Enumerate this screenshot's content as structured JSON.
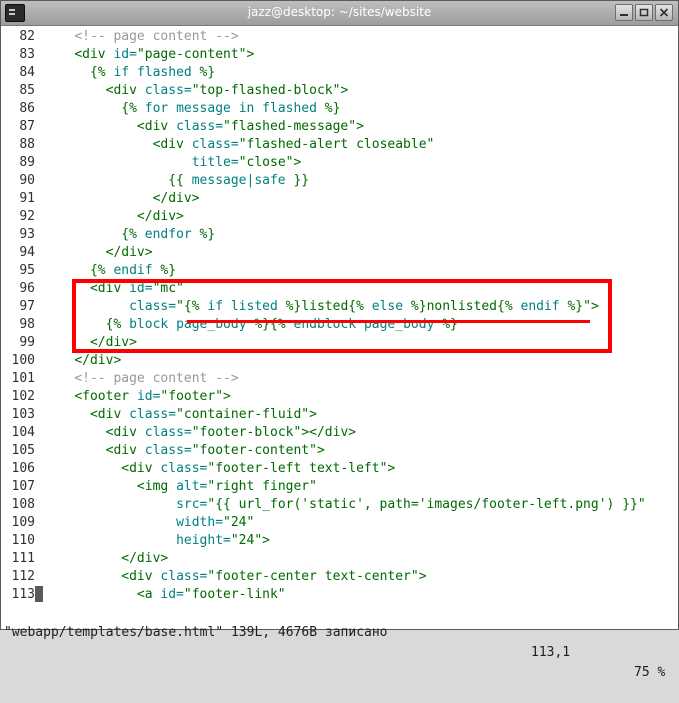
{
  "window": {
    "title": "jazz@desktop: ~/sites/website",
    "icon": "terminal-icon",
    "controls": [
      "minimize-icon",
      "maximize-icon",
      "close-icon"
    ]
  },
  "lines": [
    {
      "num": "82",
      "parts": [
        [
          "    ",
          "t"
        ],
        [
          "<!-- page content -->",
          "c"
        ]
      ]
    },
    {
      "num": "83",
      "parts": [
        [
          "    ",
          "t"
        ],
        [
          "<div ",
          "g"
        ],
        [
          "id=",
          "a"
        ],
        [
          "\"page-content\"",
          "s"
        ],
        [
          ">",
          "g"
        ]
      ]
    },
    {
      "num": "84",
      "parts": [
        [
          "      ",
          "t"
        ],
        [
          "{% ",
          "j"
        ],
        [
          "if ",
          "k"
        ],
        [
          "flashed",
          "k"
        ],
        [
          " %}",
          "j"
        ]
      ]
    },
    {
      "num": "85",
      "parts": [
        [
          "        ",
          "t"
        ],
        [
          "<div ",
          "g"
        ],
        [
          "class=",
          "a"
        ],
        [
          "\"top-flashed-block\"",
          "s"
        ],
        [
          ">",
          "g"
        ]
      ]
    },
    {
      "num": "86",
      "parts": [
        [
          "          ",
          "t"
        ],
        [
          "{% ",
          "j"
        ],
        [
          "for ",
          "k"
        ],
        [
          "message in flashed",
          "k"
        ],
        [
          " %}",
          "j"
        ]
      ]
    },
    {
      "num": "87",
      "parts": [
        [
          "            ",
          "t"
        ],
        [
          "<div ",
          "g"
        ],
        [
          "class=",
          "a"
        ],
        [
          "\"flashed-message\"",
          "s"
        ],
        [
          ">",
          "g"
        ]
      ]
    },
    {
      "num": "88",
      "parts": [
        [
          "              ",
          "t"
        ],
        [
          "<div ",
          "g"
        ],
        [
          "class=",
          "a"
        ],
        [
          "\"flashed-alert closeable\"",
          "s"
        ]
      ]
    },
    {
      "num": "89",
      "parts": [
        [
          "                   ",
          "t"
        ],
        [
          "title=",
          "a"
        ],
        [
          "\"close\"",
          "s"
        ],
        [
          ">",
          "g"
        ]
      ]
    },
    {
      "num": "90",
      "parts": [
        [
          "                ",
          "t"
        ],
        [
          "{{ ",
          "j"
        ],
        [
          "message|safe",
          "k"
        ],
        [
          " }}",
          "j"
        ]
      ]
    },
    {
      "num": "91",
      "parts": [
        [
          "              ",
          "t"
        ],
        [
          "</div>",
          "g"
        ]
      ]
    },
    {
      "num": "92",
      "parts": [
        [
          "            ",
          "t"
        ],
        [
          "</div>",
          "g"
        ]
      ]
    },
    {
      "num": "93",
      "parts": [
        [
          "          ",
          "t"
        ],
        [
          "{% ",
          "j"
        ],
        [
          "endfor",
          "k"
        ],
        [
          " %}",
          "j"
        ]
      ]
    },
    {
      "num": "94",
      "parts": [
        [
          "        ",
          "t"
        ],
        [
          "</div>",
          "g"
        ]
      ]
    },
    {
      "num": "95",
      "parts": [
        [
          "      ",
          "t"
        ],
        [
          "{% ",
          "j"
        ],
        [
          "endif",
          "k"
        ],
        [
          " %}",
          "j"
        ]
      ]
    },
    {
      "num": "96",
      "parts": [
        [
          "      ",
          "t"
        ],
        [
          "<div ",
          "g"
        ],
        [
          "id=",
          "a"
        ],
        [
          "\"mc\"",
          "s"
        ]
      ]
    },
    {
      "num": "97",
      "parts": [
        [
          "           ",
          "t"
        ],
        [
          "class=",
          "a"
        ],
        [
          "\"",
          "s"
        ],
        [
          "{% ",
          "j"
        ],
        [
          "if listed",
          "k"
        ],
        [
          " %}",
          "j"
        ],
        [
          "listed",
          "s"
        ],
        [
          "{% ",
          "j"
        ],
        [
          "else",
          "k"
        ],
        [
          " %}",
          "j"
        ],
        [
          "nonlisted",
          "s"
        ],
        [
          "{% ",
          "j"
        ],
        [
          "endif",
          "k"
        ],
        [
          " %}",
          "j"
        ],
        [
          "\"",
          "s"
        ],
        [
          ">",
          "g"
        ]
      ]
    },
    {
      "num": "98",
      "parts": [
        [
          "        ",
          "t"
        ],
        [
          "{% ",
          "j"
        ],
        [
          "block ",
          "k"
        ],
        [
          "page_body",
          "k"
        ],
        [
          " %}",
          "j"
        ],
        [
          "{% ",
          "j"
        ],
        [
          "endblock ",
          "k"
        ],
        [
          "page_body",
          "k"
        ],
        [
          " %}",
          "j"
        ]
      ]
    },
    {
      "num": "99",
      "parts": [
        [
          "      ",
          "t"
        ],
        [
          "</div>",
          "g"
        ]
      ]
    },
    {
      "num": "100",
      "parts": [
        [
          "    ",
          "t"
        ],
        [
          "</div>",
          "g"
        ]
      ]
    },
    {
      "num": "101",
      "parts": [
        [
          "    ",
          "t"
        ],
        [
          "<!-- page content -->",
          "c"
        ]
      ]
    },
    {
      "num": "102",
      "parts": [
        [
          "    ",
          "t"
        ],
        [
          "<footer ",
          "g"
        ],
        [
          "id=",
          "a"
        ],
        [
          "\"footer\"",
          "s"
        ],
        [
          ">",
          "g"
        ]
      ]
    },
    {
      "num": "103",
      "parts": [
        [
          "      ",
          "t"
        ],
        [
          "<div ",
          "g"
        ],
        [
          "class=",
          "a"
        ],
        [
          "\"container-fluid\"",
          "s"
        ],
        [
          ">",
          "g"
        ]
      ]
    },
    {
      "num": "104",
      "parts": [
        [
          "        ",
          "t"
        ],
        [
          "<div ",
          "g"
        ],
        [
          "class=",
          "a"
        ],
        [
          "\"footer-block\"",
          "s"
        ],
        [
          "></div>",
          "g"
        ]
      ]
    },
    {
      "num": "105",
      "parts": [
        [
          "        ",
          "t"
        ],
        [
          "<div ",
          "g"
        ],
        [
          "class=",
          "a"
        ],
        [
          "\"footer-content\"",
          "s"
        ],
        [
          ">",
          "g"
        ]
      ]
    },
    {
      "num": "106",
      "parts": [
        [
          "          ",
          "t"
        ],
        [
          "<div ",
          "g"
        ],
        [
          "class=",
          "a"
        ],
        [
          "\"footer-left text-left\"",
          "s"
        ],
        [
          ">",
          "g"
        ]
      ]
    },
    {
      "num": "107",
      "parts": [
        [
          "            ",
          "t"
        ],
        [
          "<img ",
          "g"
        ],
        [
          "alt=",
          "a"
        ],
        [
          "\"right finger\"",
          "s"
        ]
      ]
    },
    {
      "num": "108",
      "parts": [
        [
          "                 ",
          "t"
        ],
        [
          "src=",
          "a"
        ],
        [
          "\"{{ url_for('static', path='images/footer-left.png') }}\"",
          "s"
        ]
      ]
    },
    {
      "num": "109",
      "parts": [
        [
          "                 ",
          "t"
        ],
        [
          "width=",
          "a"
        ],
        [
          "\"24\"",
          "s"
        ]
      ]
    },
    {
      "num": "110",
      "parts": [
        [
          "                 ",
          "t"
        ],
        [
          "height=",
          "a"
        ],
        [
          "\"24\"",
          "s"
        ],
        [
          ">",
          "g"
        ]
      ]
    },
    {
      "num": "111",
      "parts": [
        [
          "          ",
          "t"
        ],
        [
          "</div>",
          "g"
        ]
      ]
    },
    {
      "num": "112",
      "parts": [
        [
          "          ",
          "t"
        ],
        [
          "<div ",
          "g"
        ],
        [
          "class=",
          "a"
        ],
        [
          "\"footer-center text-center\"",
          "s"
        ],
        [
          ">",
          "g"
        ]
      ]
    },
    {
      "num": "113",
      "parts": [
        [
          "            ",
          "t"
        ],
        [
          "<a ",
          "g"
        ],
        [
          "id=",
          "a"
        ],
        [
          "\"footer-link\"",
          "s"
        ]
      ]
    }
  ],
  "status": {
    "file": "\"webapp/templates/base.html\" 139L, 4676B записано",
    "position": "113,1",
    "percent": "75 %"
  },
  "colors": {
    "tag": "#006a00",
    "attribute": "#008080",
    "comment": "#999999",
    "annotation": "#ff0000"
  }
}
